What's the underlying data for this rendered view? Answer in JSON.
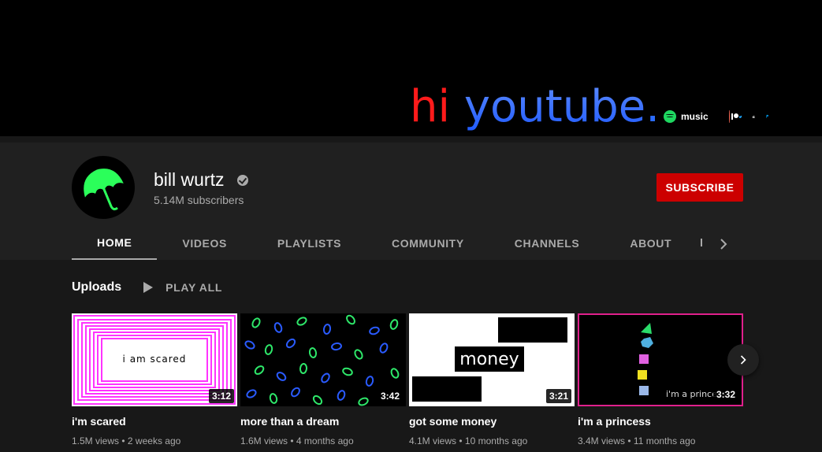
{
  "banner": {
    "title_word1": "hi",
    "title_word2": "youtube",
    "title_dot": ".",
    "links": [
      {
        "icon": "spotify-icon",
        "label": "music"
      },
      {
        "icon": "patreon-icon",
        "label": ""
      },
      {
        "icon": "twitter-icon",
        "label": ""
      },
      {
        "icon": "apple-icon",
        "label": ""
      },
      {
        "icon": "paypal-icon",
        "label": ""
      }
    ]
  },
  "channel": {
    "name": "bill wurtz",
    "subscribers": "5.14M subscribers",
    "subscribe_label": "SUBSCRIBE",
    "avatar_icon": "green-umbrella-icon"
  },
  "tabs": [
    {
      "label": "HOME",
      "active": true
    },
    {
      "label": "VIDEOS",
      "active": false
    },
    {
      "label": "PLAYLISTS",
      "active": false
    },
    {
      "label": "COMMUNITY",
      "active": false
    },
    {
      "label": "CHANNELS",
      "active": false
    },
    {
      "label": "ABOUT",
      "active": false
    }
  ],
  "uploads": {
    "title": "Uploads",
    "play_all": "PLAY ALL",
    "videos": [
      {
        "title": "i'm scared",
        "views": "1.5M views",
        "age": "2 weeks ago",
        "duration": "3:12",
        "thumb_text": "i am scared"
      },
      {
        "title": "more than a dream",
        "views": "1.6M views",
        "age": "4 months ago",
        "duration": "3:42",
        "thumb_text": ""
      },
      {
        "title": "got some money",
        "views": "4.1M views",
        "age": "10 months ago",
        "duration": "3:21",
        "thumb_text": "money"
      },
      {
        "title": "i'm a princess",
        "views": "3.4M views",
        "age": "11 months ago",
        "duration": "3:32",
        "thumb_text": "i'm a princess"
      }
    ],
    "meta_separator": "•"
  },
  "colors": {
    "subscribe_red": "#cc0000",
    "banner_red": "#ff1b1b",
    "banner_blue": "#2b6cff",
    "spotify_green": "#1ed760",
    "twitter_blue": "#1da1f2",
    "paypal_blue": "#009cde"
  }
}
